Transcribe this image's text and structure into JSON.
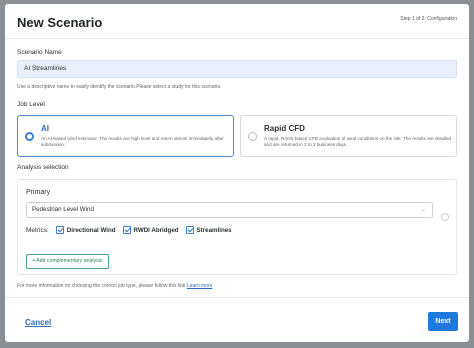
{
  "modal": {
    "title": "New Scenario",
    "step": "Step 1 of 2: Configuration"
  },
  "scenario_name": {
    "label": "Scenario Name",
    "value": "AI Streamlines",
    "hint": "Use a descriptive name to easily identify the scenario.Please select a study for this scenario."
  },
  "job_level": {
    "label": "Job Level",
    "options": [
      {
        "title": "AI",
        "desc": "An AI-based wind estimator. The results are high level and return almost immediately after submission.",
        "selected": true
      },
      {
        "title": "Rapid CFD",
        "desc": "A rapid, RANS based CFD evaluation of wind conditions on the site. The results are detailed and are returned in 2 to 3 business days.",
        "selected": false
      }
    ]
  },
  "analysis": {
    "label": "Analysis selection",
    "primary_label": "Primary",
    "primary_value": "Pedestrian Level Wind",
    "metrics_label": "Metrics:",
    "metrics": [
      "Directional Wind",
      "RWDI Abridged",
      "Streamlines"
    ],
    "add_button": "+ Add complementary analysis"
  },
  "footer": {
    "info_text": "For more information on choosing the correct job type, please follow this link",
    "link_text": "Learn more",
    "cancel": "Cancel",
    "next": "Next"
  },
  "colors": {
    "accent": "#1f7ae0",
    "selected_border": "#4a90d9",
    "add_button": "#2f7f58"
  }
}
